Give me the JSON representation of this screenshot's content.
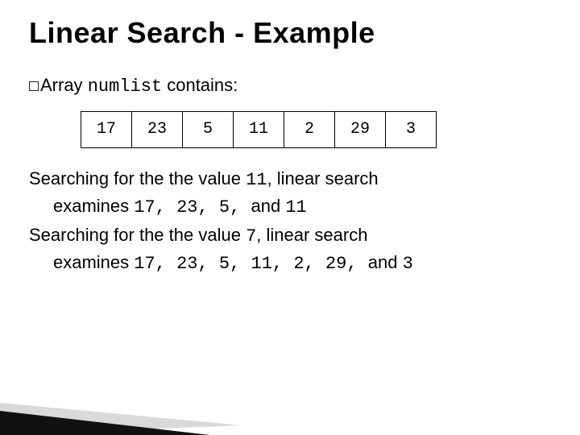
{
  "title": "Linear Search - Example",
  "bullet1": {
    "prefix": "Array ",
    "code": "numlist",
    "suffix": " contains:"
  },
  "array_values": [
    "17",
    "23",
    "5",
    "11",
    "2",
    "29",
    "3"
  ],
  "para": {
    "l1a": "Searching for the the value ",
    "l1b": "11",
    "l1c": ", linear search",
    "l2a": "examines ",
    "l2b": "17, 23, 5, ",
    "l2c": "and ",
    "l2d": "11",
    "l3a": "Searching for the the value ",
    "l3b": "7",
    "l3c": ", linear search",
    "l4a": "examines ",
    "l4b": "17, 23, 5, 11, 2, 29, ",
    "l4c": "and ",
    "l4d": "3"
  }
}
